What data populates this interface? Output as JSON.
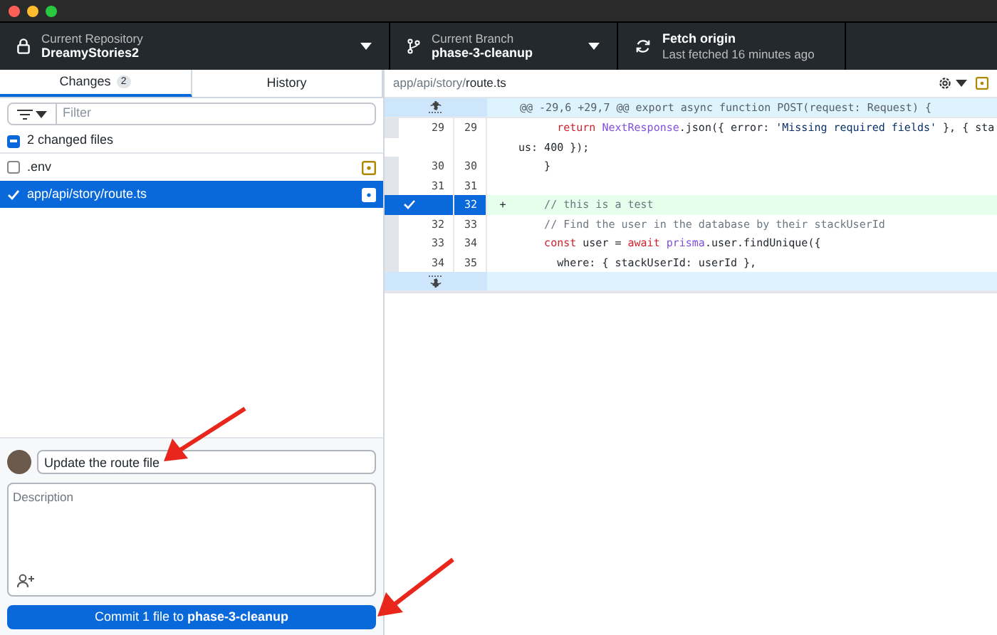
{
  "toolbar": {
    "repository": {
      "label": "Current Repository",
      "name": "DreamyStories2"
    },
    "branch": {
      "label": "Current Branch",
      "name": "phase-3-cleanup"
    },
    "fetch": {
      "title": "Fetch origin",
      "subtitle": "Last fetched 16 minutes ago"
    }
  },
  "tabs": [
    {
      "label": "Changes",
      "count": "2",
      "selected": true
    },
    {
      "label": "History",
      "selected": false
    }
  ],
  "filter": {
    "placeholder": "Filter"
  },
  "changes_header": {
    "label": "2 changed files",
    "partial": true
  },
  "files": [
    {
      "path": ".env",
      "checked": false,
      "selected": false
    },
    {
      "path": "app/api/story/route.ts",
      "checked": true,
      "selected": true
    }
  ],
  "diff": {
    "path_dir": "app/api/story/",
    "path_file": "route.ts",
    "lines": [
      {
        "kind": "hunk",
        "text": "@@ -29,6 +29,7 @@ export async function POST(request: Request) {"
      },
      {
        "kind": "context",
        "old": "29",
        "new": "29",
        "tokens": [
          {
            "kind": "keyword",
            "text": "      return"
          },
          {
            "kind": "type",
            "text": " NextResponse"
          },
          {
            "kind": "plain",
            "text": ".json({ error: "
          },
          {
            "kind": "string",
            "text": "'Missing required fields'"
          },
          {
            "kind": "plain",
            "text": " }, { sta"
          }
        ]
      },
      {
        "kind": "wrap",
        "tokens": [
          {
            "kind": "plain",
            "text": "us: 400 });"
          }
        ]
      },
      {
        "kind": "context",
        "old": "30",
        "new": "30",
        "tokens": [
          {
            "kind": "plain",
            "text": "    }"
          }
        ]
      },
      {
        "kind": "context",
        "old": "31",
        "new": "31"
      },
      {
        "kind": "added",
        "new": "32",
        "selected": true,
        "marker": "+",
        "tokens": [
          {
            "kind": "comment",
            "text": "    // this is a test"
          }
        ]
      },
      {
        "kind": "context",
        "old": "32",
        "new": "33",
        "tokens": [
          {
            "kind": "comment",
            "text": "    // Find the user in the database by their stackUserId"
          }
        ]
      },
      {
        "kind": "context",
        "old": "33",
        "new": "34",
        "tokens": [
          {
            "kind": "keyword",
            "text": "    const"
          },
          {
            "kind": "plain",
            "text": " user = "
          },
          {
            "kind": "keyword",
            "text": "await"
          },
          {
            "kind": "type",
            "text": " prisma"
          },
          {
            "kind": "plain",
            "text": ".user.findUnique({"
          }
        ]
      },
      {
        "kind": "context",
        "old": "34",
        "new": "35",
        "tokens": [
          {
            "kind": "plain",
            "text": "      where: { stackUserId: userId },"
          }
        ]
      },
      {
        "kind": "expand"
      }
    ]
  },
  "commit": {
    "summary": "Update the route file",
    "description_placeholder": "Description",
    "button": "Commit 1 file to **phase-3-cleanup**"
  }
}
